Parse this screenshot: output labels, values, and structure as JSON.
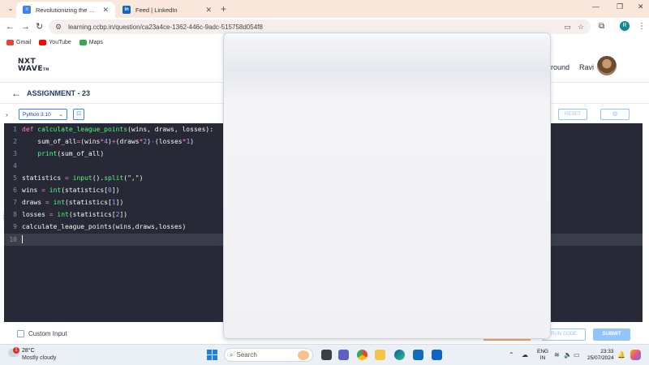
{
  "browser": {
    "tabs": [
      {
        "title": "Revolutionizing the Job Market",
        "active": true,
        "favicon_color": "#3b82f6"
      },
      {
        "title": "Feed | LinkedIn",
        "active": false,
        "favicon_color": "#0a66c2",
        "favicon_text": "in"
      }
    ],
    "url": "learning.ccbp.in/question/ca23a4ce-1362-446c-9adc-515758d054f8",
    "profile_initial": "R",
    "bookmarks": [
      {
        "label": "Gmail",
        "color": "#ea4335"
      },
      {
        "label": "YouTube",
        "color": "#ff0000"
      },
      {
        "label": "Maps",
        "color": "#34a853"
      }
    ]
  },
  "header": {
    "logo_line1": "NXT",
    "logo_line2": "WAVE",
    "logo_suffix": "TM",
    "nav_partial": "ground",
    "username": "Ravi"
  },
  "assignment": {
    "title": "ASSIGNMENT - 23"
  },
  "editor_toolbar": {
    "language": "Python 3.10",
    "reset_label": "RESET"
  },
  "code": {
    "lines": [
      {
        "n": "1",
        "text": "def calculate_league_points(wins, draws, losses):"
      },
      {
        "n": "2",
        "text": "    sum_of_all=(wins*4)+(draws*2)-(losses*1)"
      },
      {
        "n": "3",
        "text": "    print(sum_of_all)"
      },
      {
        "n": "4",
        "text": ""
      },
      {
        "n": "5",
        "text": "statistics = input().split(\",\")"
      },
      {
        "n": "6",
        "text": "wins = int(statistics[0])"
      },
      {
        "n": "7",
        "text": "draws = int(statistics[1])"
      },
      {
        "n": "8",
        "text": "losses = int(statistics[2])"
      },
      {
        "n": "9",
        "text": "calculate_league_points(wins,draws,losses)"
      },
      {
        "n": "10",
        "text": ""
      }
    ]
  },
  "bottom": {
    "custom_input_label": "Custom Input",
    "run_code_label": "RUN CODE",
    "submit_label": "SUBMIT"
  },
  "taskbar": {
    "weather_badge": "1",
    "temperature": "28°C",
    "weather": "Mostly cloudy",
    "search_placeholder": "Search",
    "lang_line1": "ENG",
    "lang_line2": "IN",
    "time": "23:33",
    "date": "25/07/2024"
  }
}
